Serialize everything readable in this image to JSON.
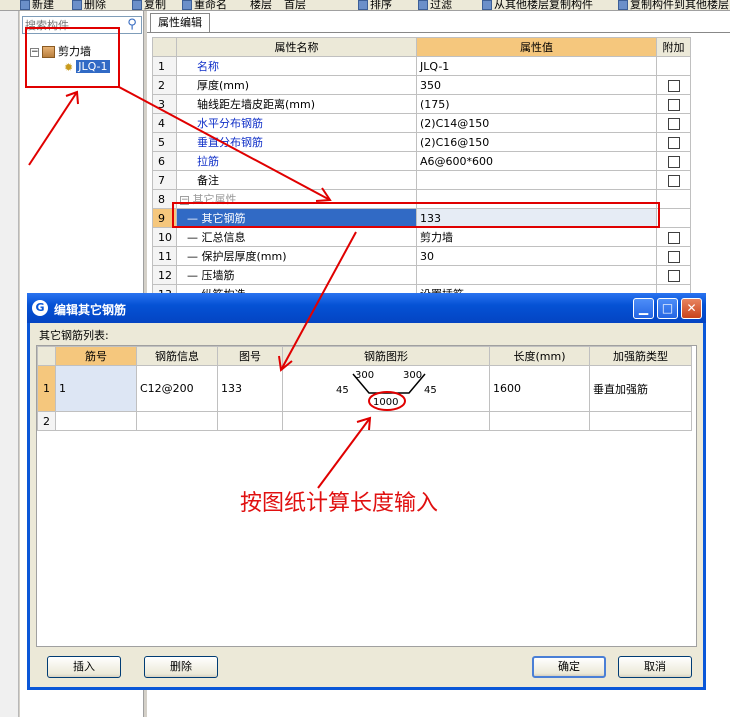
{
  "toolbar": {
    "items": [
      "新建",
      "删除",
      "复制",
      "重命名",
      "楼层",
      "首层",
      "排序",
      "过滤",
      "从其他楼层复制构件",
      "复制构件到其他楼层"
    ]
  },
  "tree": {
    "search_placeholder": "搜索构件",
    "root_label": "剪力墙",
    "root_expander": "−",
    "child_label": "JLQ-1"
  },
  "properties": {
    "tab_label": "属性编辑",
    "col_name": "属性名称",
    "col_value": "属性值",
    "col_attach": "附加",
    "rows": [
      {
        "num": "1",
        "name": "名称",
        "value": "JLQ-1"
      },
      {
        "num": "2",
        "name": "厚度(mm)",
        "value": "350"
      },
      {
        "num": "3",
        "name": "轴线距左墙皮距离(mm)",
        "value": "(175)"
      },
      {
        "num": "4",
        "name": "水平分布钢筋",
        "value": "(2)C14@150"
      },
      {
        "num": "5",
        "name": "垂直分布钢筋",
        "value": "(2)C16@150"
      },
      {
        "num": "6",
        "name": "拉筋",
        "value": "A6@600*600"
      },
      {
        "num": "7",
        "name": "备注",
        "value": ""
      },
      {
        "num": "8",
        "name": "其它属性",
        "value": ""
      },
      {
        "num": "9",
        "name": "其它钢筋",
        "value": "133"
      },
      {
        "num": "10",
        "name": "汇总信息",
        "value": "剪力墙"
      },
      {
        "num": "11",
        "name": "保护层厚度(mm)",
        "value": "30"
      },
      {
        "num": "12",
        "name": "压墙筋",
        "value": ""
      },
      {
        "num": "13",
        "name": "纵筋构造",
        "value": "设置插筋"
      }
    ]
  },
  "dialog": {
    "title": "编辑其它钢筋",
    "icon": "app-icon",
    "subtitle": "其它钢筋列表:",
    "columns": [
      "筋号",
      "钢筋信息",
      "图号",
      "钢筋图形",
      "长度(mm)",
      "加强筋类型"
    ],
    "rows": [
      {
        "num": "1",
        "bar_no": "1",
        "info": "C12@200",
        "fig": "133",
        "length": "1600",
        "type": "垂直加强筋"
      },
      {
        "num": "2",
        "bar_no": "",
        "info": "",
        "fig": "",
        "length": "",
        "type": ""
      }
    ],
    "shape": {
      "left_len": "300",
      "right_len": "300",
      "left_angle": "45",
      "right_angle": "45",
      "bottom_len": "1000"
    },
    "buttons": {
      "insert": "插入",
      "delete": "删除",
      "ok": "确定",
      "cancel": "取消"
    },
    "win_buttons": {
      "minimize": "▁",
      "maximize": "□",
      "close": "✕"
    }
  },
  "annotation": {
    "text": "按图纸计算长度输入"
  },
  "colors": {
    "annotation": "#e00000",
    "title_bar": "#0552d5",
    "selection": "#316ac5"
  }
}
